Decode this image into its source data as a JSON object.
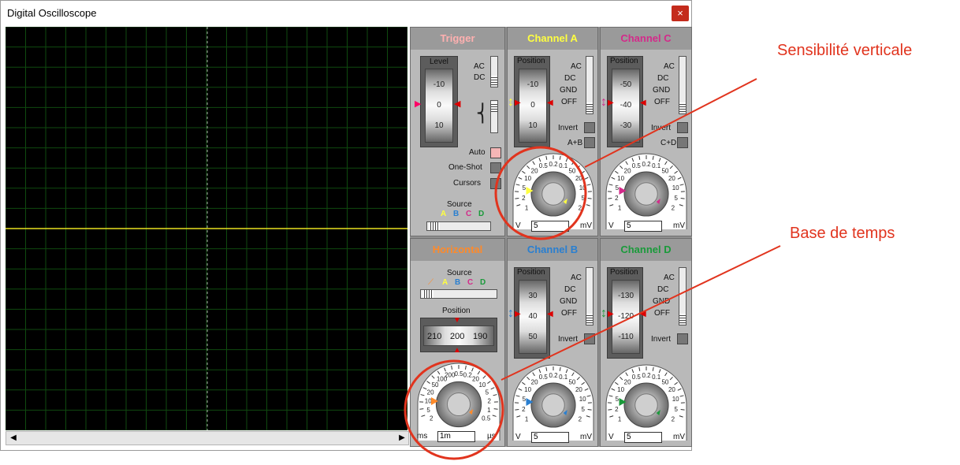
{
  "window": {
    "title": "Digital Oscilloscope",
    "close_glyph": "×"
  },
  "colors": {
    "trace": "#e8e020",
    "grid": "#0f4a0f",
    "chanA": "#ffff40",
    "chanB": "#2a7fd0",
    "chanC": "#d42a8a",
    "chanD": "#1a9a3a",
    "trigger": "#ffb0b0",
    "horizontal": "#ff8a2a",
    "annotation": "#e1341e"
  },
  "trigger": {
    "header": "Trigger",
    "level_label": "Level",
    "drum": [
      "-10",
      "0",
      "10"
    ],
    "ac": "AC",
    "dc": "DC",
    "auto": "Auto",
    "oneshot": "One-Shot",
    "cursors": "Cursors",
    "source_label": "Source",
    "sources": [
      "A",
      "B",
      "C",
      "D"
    ]
  },
  "horizontal": {
    "header": "Horizontal",
    "source_label": "Source",
    "sources": [
      "A",
      "B",
      "C",
      "D"
    ],
    "position_label": "Position",
    "pos_values": [
      "210",
      "200",
      "190"
    ],
    "dial_left": [
      "2",
      "5",
      "10",
      "20",
      "50",
      "100",
      "200"
    ],
    "dial_top": [
      "0.5",
      "0.2"
    ],
    "dial_right": [
      "20",
      "10",
      "5",
      "2",
      "1",
      "0.5"
    ],
    "unit_left": "ms",
    "unit_right": "µs",
    "value": "1m"
  },
  "channels": [
    {
      "id": "A",
      "header": "Channel A",
      "position_label": "Position",
      "drum": [
        "-10",
        "0",
        "10"
      ],
      "opts": [
        "AC",
        "DC",
        "GND",
        "OFF"
      ],
      "invert": "Invert",
      "extra": "A+B",
      "dial_left": [
        "1",
        "2",
        "5",
        "10",
        "20"
      ],
      "dial_top": [
        "0.5",
        "0.2",
        "0.1"
      ],
      "dial_right": [
        "50",
        "20",
        "10",
        "5",
        "2"
      ],
      "unit_left": "V",
      "unit_right": "mV",
      "value": "5"
    },
    {
      "id": "C",
      "header": "Channel C",
      "position_label": "Position",
      "drum": [
        "-50",
        "-40",
        "-30"
      ],
      "opts": [
        "AC",
        "DC",
        "GND",
        "OFF"
      ],
      "invert": "Invert",
      "extra": "C+D",
      "dial_left": [
        "1",
        "2",
        "5",
        "10",
        "20"
      ],
      "dial_top": [
        "0.5",
        "0.2",
        "0.1"
      ],
      "dial_right": [
        "50",
        "20",
        "10",
        "5",
        "2"
      ],
      "unit_left": "V",
      "unit_right": "mV",
      "value": "5"
    },
    {
      "id": "B",
      "header": "Channel B",
      "position_label": "Position",
      "drum": [
        "30",
        "40",
        "50"
      ],
      "opts": [
        "AC",
        "DC",
        "GND",
        "OFF"
      ],
      "invert": "Invert",
      "extra": "",
      "dial_left": [
        "1",
        "2",
        "5",
        "10",
        "20"
      ],
      "dial_top": [
        "0.5",
        "0.2",
        "0.1"
      ],
      "dial_right": [
        "50",
        "20",
        "10",
        "5",
        "2"
      ],
      "unit_left": "V",
      "unit_right": "mV",
      "value": "5"
    },
    {
      "id": "D",
      "header": "Channel D",
      "position_label": "Position",
      "drum": [
        "-130",
        "-120",
        "-110"
      ],
      "opts": [
        "AC",
        "DC",
        "GND",
        "OFF"
      ],
      "invert": "Invert",
      "extra": "",
      "dial_left": [
        "1",
        "2",
        "5",
        "10",
        "20"
      ],
      "dial_top": [
        "0.5",
        "0.2",
        "0.1"
      ],
      "dial_right": [
        "50",
        "20",
        "10",
        "5",
        "2"
      ],
      "unit_left": "V",
      "unit_right": "mV",
      "value": "5"
    }
  ],
  "annotations": {
    "vertical": "Sensibilité verticale",
    "timebase": "Base de temps"
  }
}
